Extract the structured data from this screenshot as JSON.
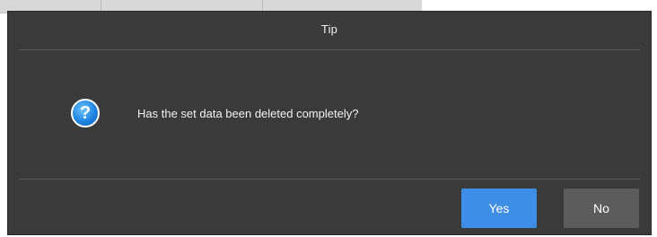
{
  "dialog": {
    "title": "Tip",
    "icon": "question-icon",
    "message": "Has the set data been deleted completely?",
    "buttons": {
      "yes_label": "Yes",
      "no_label": "No"
    }
  },
  "colors": {
    "dialog_bg": "#3a3a3a",
    "yes_button": "#3f8ee6",
    "no_button": "#5c5c5c",
    "icon_blue": "#1f84e0"
  }
}
